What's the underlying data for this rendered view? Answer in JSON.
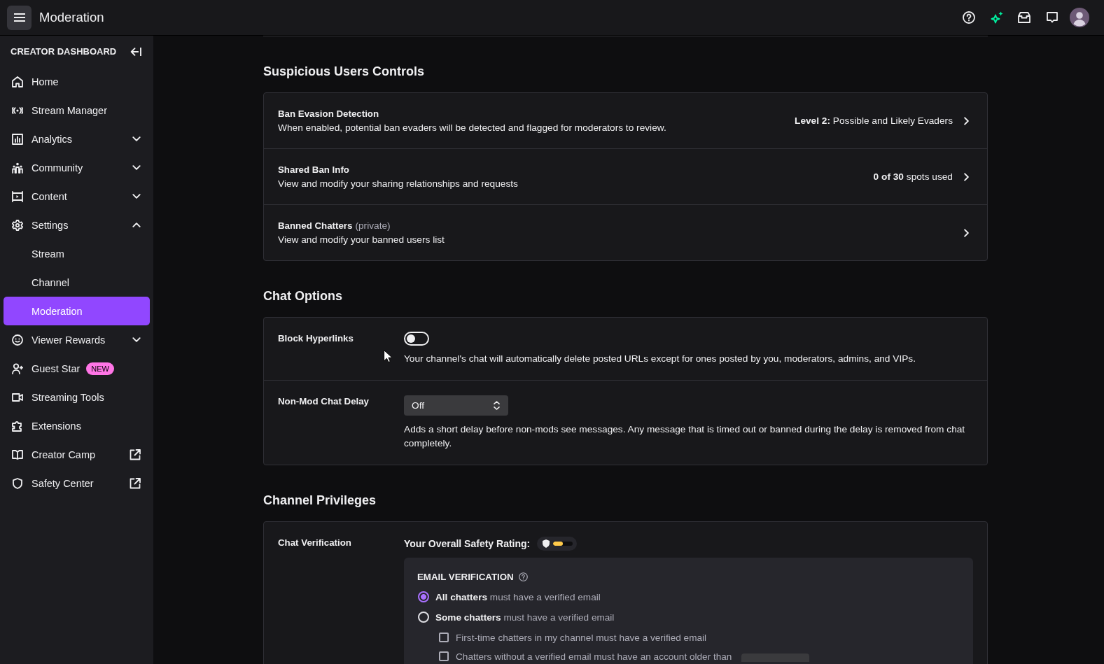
{
  "topbar": {
    "title": "Moderation"
  },
  "sidebar": {
    "heading": "CREATOR DASHBOARD",
    "items": [
      {
        "label": "Home",
        "kind": "page",
        "selected": false
      },
      {
        "label": "Stream Manager",
        "kind": "page",
        "selected": false
      },
      {
        "label": "Analytics",
        "kind": "group",
        "expanded": false,
        "selected": false
      },
      {
        "label": "Community",
        "kind": "group",
        "expanded": false,
        "selected": false
      },
      {
        "label": "Content",
        "kind": "group",
        "expanded": false,
        "selected": false
      },
      {
        "label": "Settings",
        "kind": "group",
        "expanded": true,
        "selected": false,
        "children": [
          {
            "label": "Stream",
            "selected": false
          },
          {
            "label": "Channel",
            "selected": false
          },
          {
            "label": "Moderation",
            "selected": true
          }
        ]
      },
      {
        "label": "Viewer Rewards",
        "kind": "group",
        "expanded": false,
        "selected": false
      },
      {
        "label": "Guest Star",
        "kind": "page",
        "badge": "NEW",
        "selected": false
      },
      {
        "label": "Streaming Tools",
        "kind": "page",
        "selected": false
      },
      {
        "label": "Extensions",
        "kind": "page",
        "selected": false
      },
      {
        "label": "Creator Camp",
        "kind": "external",
        "selected": false
      },
      {
        "label": "Safety Center",
        "kind": "external",
        "selected": false
      }
    ]
  },
  "sections": [
    {
      "title": "Suspicious Users Controls",
      "kind": "links",
      "rows": [
        {
          "title": "Ban Evasion Detection",
          "description": "When enabled, potential ban evaders will be detected and flagged for moderators to review.",
          "value": "**Level 2:** Possible and Likely Evaders"
        },
        {
          "title": "Shared Ban Info",
          "description": "View and modify your sharing relationships and requests",
          "value": "**0 of 30** spots used"
        },
        {
          "title": "Banned Chatters",
          "note": "(private)",
          "description": "View and modify your banned users list"
        }
      ]
    },
    {
      "title": "Chat Options",
      "kind": "settings",
      "rows": [
        {
          "label": "Block Hyperlinks",
          "kind": "toggle",
          "on": false,
          "description": "Your channel's chat will automatically delete posted URLs except for ones posted by you, moderators, admins, and VIPs."
        },
        {
          "label": "Non-Mod Chat Delay",
          "kind": "select",
          "value": "Off",
          "description": "Adds a short delay before non-mods see messages. Any message that is timed out or banned during the delay is removed from chat completely."
        }
      ]
    },
    {
      "title": "Channel Privileges",
      "kind": "settings",
      "rows": [
        {
          "label": "Chat Verification",
          "kind": "verification",
          "rating_label": "Your Overall Safety Rating:",
          "rating": {
            "level": 0.5
          },
          "panel": {
            "title": "EMAIL VERIFICATION",
            "options": [
              {
                "label": "**All chatters** must have a verified email",
                "selected": true
              },
              {
                "label": "**Some chatters** must have a verified email",
                "selected": false
              }
            ],
            "checks": [
              {
                "label": "First-time chatters in my channel must have a verified email",
                "kind": "plain",
                "checked": false
              },
              {
                "label": "Chatters without a verified email must have an account older than",
                "kind": "with_select",
                "checked": false
              }
            ]
          }
        }
      ]
    }
  ]
}
